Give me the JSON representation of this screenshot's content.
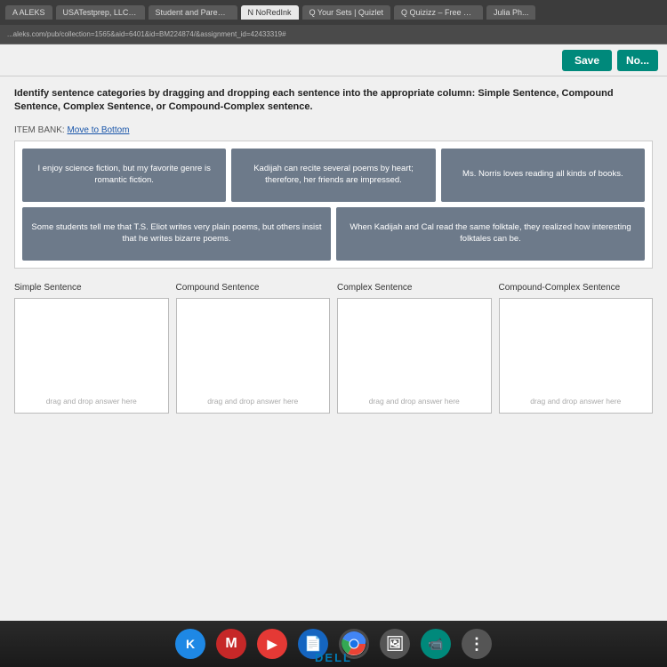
{
  "browser": {
    "url": "...aleks.com/pub/collection=1565&aid=6401&id=BM224874/&assignment_id=42433319#",
    "tabs": [
      {
        "label": "ALEKS",
        "active": false
      },
      {
        "label": "USATestprep, LLC -...",
        "active": false
      },
      {
        "label": "Student and Parent...",
        "active": false
      },
      {
        "label": "NoRedInk",
        "active": false
      },
      {
        "label": "Your Sets | Quizlet",
        "active": false
      },
      {
        "label": "Quizizz – Free Quiz...",
        "active": false
      },
      {
        "label": "Julia Ph...",
        "active": false
      }
    ]
  },
  "toolbar": {
    "save_label": "Save",
    "next_label": "No..."
  },
  "instructions": {
    "text": "Identify sentence categories by dragging and dropping each sentence into the appropriate column: Simple Sentence, Compound Sentence, Complex Sentence, or Compound-Complex sentence."
  },
  "item_bank": {
    "label": "ITEM BANK:",
    "move_to_bottom": "Move to Bottom",
    "sentences": [
      {
        "id": "s1",
        "text": "I enjoy science fiction, but my favorite genre is romantic fiction."
      },
      {
        "id": "s2",
        "text": "Kadijah can recite several poems by heart; therefore, her friends are impressed."
      },
      {
        "id": "s3",
        "text": "Ms. Norris loves reading all kinds of books."
      },
      {
        "id": "s4",
        "text": "Some students tell me that T.S. Eliot writes very plain poems, but others insist that he writes bizarre poems."
      },
      {
        "id": "s5",
        "text": "When Kadijah and Cal read the same folktale, they realized how interesting folktales can be."
      }
    ]
  },
  "drop_zones": [
    {
      "id": "simple",
      "label": "Simple Sentence",
      "hint": "drag and drop answer here"
    },
    {
      "id": "compound",
      "label": "Compound Sentence",
      "hint": "drag and drop answer here"
    },
    {
      "id": "complex",
      "label": "Complex Sentence",
      "hint": "drag and drop answer here"
    },
    {
      "id": "compound-complex",
      "label": "Compound-Complex Sentence",
      "hint": "drag and drop answer here"
    }
  ],
  "taskbar": {
    "icons": [
      {
        "name": "K",
        "color": "#1e88e5",
        "label": "kiosk"
      },
      {
        "name": "M",
        "color": "#c62828",
        "label": "gmail"
      },
      {
        "name": "▶",
        "color": "#e53935",
        "label": "youtube"
      },
      {
        "name": "📄",
        "color": "#1565c0",
        "label": "drive"
      },
      {
        "name": "⬤",
        "color": "multicolor",
        "label": "chrome"
      },
      {
        "name": "🖼",
        "color": "#555",
        "label": "photos"
      },
      {
        "name": "📹",
        "color": "#00897b",
        "label": "meet"
      },
      {
        "name": "⠿",
        "color": "#555",
        "label": "dots"
      }
    ]
  },
  "dell_logo": "DELL"
}
